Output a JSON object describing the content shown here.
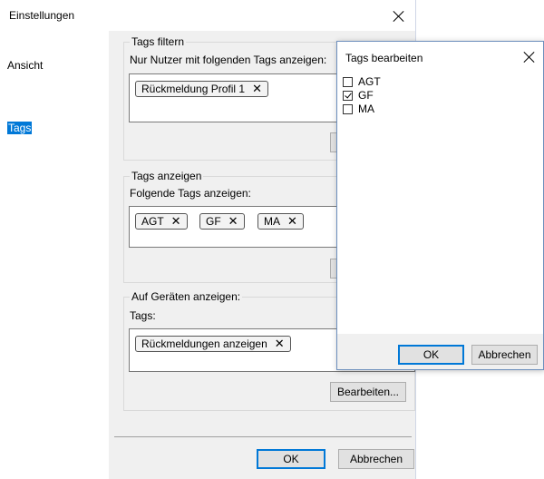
{
  "main_window": {
    "title": "Einstellungen",
    "nav": [
      {
        "label": "Ansicht",
        "selected": false
      },
      {
        "label": "Tags",
        "selected": true
      }
    ],
    "groups": {
      "filter": {
        "title": "Tags filtern",
        "subtitle": "Nur Nutzer mit folgenden Tags anzeigen:",
        "tags": [
          "Rückmeldung Profil 1"
        ]
      },
      "display": {
        "title": "Tags anzeigen",
        "subtitle": "Folgende Tags anzeigen:",
        "tags": [
          "AGT",
          "GF",
          "MA"
        ]
      },
      "devices": {
        "title": "Auf Geräten anzeigen:",
        "subtitle": "Tags:",
        "tags": [
          "Rückmeldungen anzeigen"
        ],
        "edit_button": "Bearbeiten..."
      }
    },
    "chip_remove_glyph": "✕",
    "buttons": {
      "ok": "OK",
      "cancel": "Abbrechen"
    }
  },
  "tags_dialog": {
    "title": "Tags bearbeiten",
    "items": [
      {
        "label": "AGT",
        "checked": false
      },
      {
        "label": "GF",
        "checked": true
      },
      {
        "label": "MA",
        "checked": false
      }
    ],
    "buttons": {
      "ok": "OK",
      "cancel": "Abbrechen"
    }
  }
}
